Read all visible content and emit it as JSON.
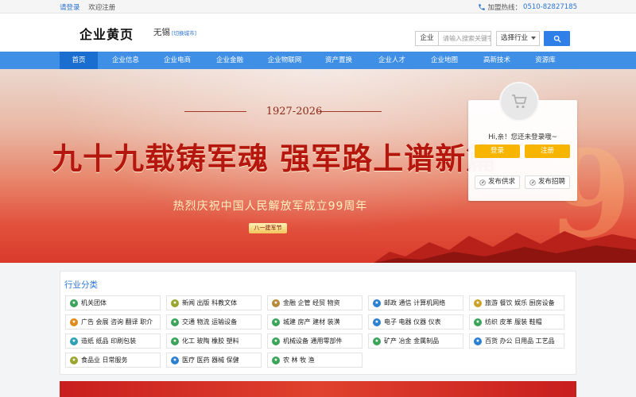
{
  "topbar": {
    "login": "请登录",
    "register": "欢迎注册",
    "hotline_label": "加盟热线：",
    "hotline_number": "0510-82827185"
  },
  "header": {
    "logo": "企业黄页",
    "city": "无锡",
    "switch_city": "[切换城市]",
    "search_type": "企业",
    "search_placeholder": "请输入搜索关键字",
    "industry_select": "选择行业"
  },
  "nav": {
    "items": [
      {
        "label": "首页",
        "active": true
      },
      {
        "label": "企业信息"
      },
      {
        "label": "企业电商"
      },
      {
        "label": "企业金融"
      },
      {
        "label": "企业物联网"
      },
      {
        "label": "资产置换"
      },
      {
        "label": "企业人才"
      },
      {
        "label": "企业地图"
      },
      {
        "label": "高新技术"
      },
      {
        "label": "资源库"
      }
    ]
  },
  "banner": {
    "years": "1927-2026",
    "headline": "九十九载铸军魂 强军路上谱新篇",
    "subline": "热烈庆祝中国人民解放军成立99周年",
    "tag": "八一建军节"
  },
  "login_panel": {
    "greeting": "Hi,亲！您还未登录哦~",
    "login_btn": "登录",
    "register_btn": "注册",
    "post_supply": "发布供求",
    "post_job": "发布招聘"
  },
  "categories": {
    "title": "行业分类",
    "items": [
      {
        "label": "机关团体",
        "color": "#3aa35a"
      },
      {
        "label": "新闻 出版 科教文体",
        "color": "#9aa52e"
      },
      {
        "label": "金融 企管 经贸 物资",
        "color": "#b58a3a"
      },
      {
        "label": "邮政 通信 计算机网络",
        "color": "#2a7fd0"
      },
      {
        "label": "旅游 餐饮 娱乐 厨房设备",
        "color": "#c9a227"
      },
      {
        "label": "广告 会展 咨询 翻译 职介",
        "color": "#e08a1a"
      },
      {
        "label": "交通 物流 运输设备",
        "color": "#3aa35a"
      },
      {
        "label": "城建 房产 建材 装潢",
        "color": "#3aa35a"
      },
      {
        "label": "电子 电器 仪器 仪表",
        "color": "#2a7fd0"
      },
      {
        "label": "纺织 皮革 服装 鞋帽",
        "color": "#3aa35a"
      },
      {
        "label": "造纸 纸品 印刷包装",
        "color": "#2ea0b5"
      },
      {
        "label": "化工 玻陶 橡胶 塑料",
        "color": "#3aa35a"
      },
      {
        "label": "机械设备 通用零部件",
        "color": "#3aa35a"
      },
      {
        "label": "矿产 冶金 金属制品",
        "color": "#3aa35a"
      },
      {
        "label": "百货 办公 日用品 工艺品",
        "color": "#2a7fd0"
      },
      {
        "label": "食品业 日常服务",
        "color": "#9aa52e"
      },
      {
        "label": "医疗 医药 器械 保健",
        "color": "#2a7fd0"
      },
      {
        "label": "农 林 牧 渔",
        "color": "#3aa35a"
      }
    ]
  }
}
